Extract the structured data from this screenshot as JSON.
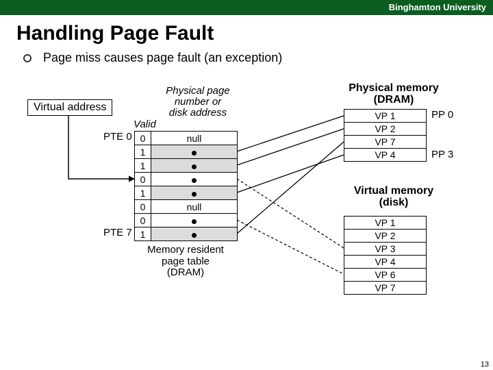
{
  "header": {
    "university": "Binghamton University"
  },
  "title": "Handling Page Fault",
  "bullet": "Page miss causes page fault (an exception)",
  "virtual_address_label": "Virtual address",
  "page_table": {
    "header_col1": "Valid",
    "header_col2": "Physical page\nnumber or\ndisk address",
    "row_label_first": "PTE 0",
    "row_label_last": "PTE 7",
    "rows": [
      {
        "valid": "0",
        "addr": "null",
        "grey": false
      },
      {
        "valid": "1",
        "addr": "●",
        "grey": true
      },
      {
        "valid": "1",
        "addr": "●",
        "grey": true
      },
      {
        "valid": "0",
        "addr": "●",
        "grey": false
      },
      {
        "valid": "1",
        "addr": "●",
        "grey": true
      },
      {
        "valid": "0",
        "addr": "null",
        "grey": false
      },
      {
        "valid": "0",
        "addr": "●",
        "grey": false
      },
      {
        "valid": "1",
        "addr": "●",
        "grey": true
      }
    ],
    "caption": "Memory resident\npage table\n(DRAM)"
  },
  "phys_mem": {
    "title": "Physical memory\n(DRAM)",
    "cells": [
      "VP 1",
      "VP 2",
      "VP 7",
      "VP 4"
    ],
    "pp0": "PP 0",
    "pp3": "PP 3"
  },
  "virt_mem": {
    "title": "Virtual memory\n(disk)",
    "cells": [
      "VP 1",
      "VP 2",
      "VP 3",
      "VP 4",
      "VP 6",
      "VP 7"
    ]
  },
  "page_number": "13"
}
